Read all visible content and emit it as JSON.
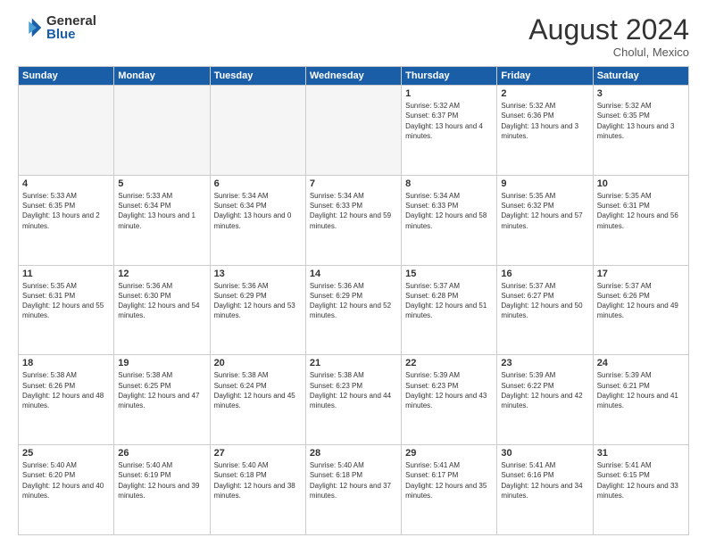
{
  "header": {
    "logo_general": "General",
    "logo_blue": "Blue",
    "month": "August 2024",
    "location": "Cholul, Mexico"
  },
  "weekdays": [
    "Sunday",
    "Monday",
    "Tuesday",
    "Wednesday",
    "Thursday",
    "Friday",
    "Saturday"
  ],
  "weeks": [
    [
      {
        "day": "",
        "empty": true
      },
      {
        "day": "",
        "empty": true
      },
      {
        "day": "",
        "empty": true
      },
      {
        "day": "",
        "empty": true
      },
      {
        "day": "1",
        "sunrise": "5:32 AM",
        "sunset": "6:37 PM",
        "daylight": "13 hours and 4 minutes."
      },
      {
        "day": "2",
        "sunrise": "5:32 AM",
        "sunset": "6:36 PM",
        "daylight": "13 hours and 3 minutes."
      },
      {
        "day": "3",
        "sunrise": "5:32 AM",
        "sunset": "6:35 PM",
        "daylight": "13 hours and 3 minutes."
      }
    ],
    [
      {
        "day": "4",
        "sunrise": "5:33 AM",
        "sunset": "6:35 PM",
        "daylight": "13 hours and 2 minutes."
      },
      {
        "day": "5",
        "sunrise": "5:33 AM",
        "sunset": "6:34 PM",
        "daylight": "13 hours and 1 minute."
      },
      {
        "day": "6",
        "sunrise": "5:34 AM",
        "sunset": "6:34 PM",
        "daylight": "13 hours and 0 minutes."
      },
      {
        "day": "7",
        "sunrise": "5:34 AM",
        "sunset": "6:33 PM",
        "daylight": "12 hours and 59 minutes."
      },
      {
        "day": "8",
        "sunrise": "5:34 AM",
        "sunset": "6:33 PM",
        "daylight": "12 hours and 58 minutes."
      },
      {
        "day": "9",
        "sunrise": "5:35 AM",
        "sunset": "6:32 PM",
        "daylight": "12 hours and 57 minutes."
      },
      {
        "day": "10",
        "sunrise": "5:35 AM",
        "sunset": "6:31 PM",
        "daylight": "12 hours and 56 minutes."
      }
    ],
    [
      {
        "day": "11",
        "sunrise": "5:35 AM",
        "sunset": "6:31 PM",
        "daylight": "12 hours and 55 minutes."
      },
      {
        "day": "12",
        "sunrise": "5:36 AM",
        "sunset": "6:30 PM",
        "daylight": "12 hours and 54 minutes."
      },
      {
        "day": "13",
        "sunrise": "5:36 AM",
        "sunset": "6:29 PM",
        "daylight": "12 hours and 53 minutes."
      },
      {
        "day": "14",
        "sunrise": "5:36 AM",
        "sunset": "6:29 PM",
        "daylight": "12 hours and 52 minutes."
      },
      {
        "day": "15",
        "sunrise": "5:37 AM",
        "sunset": "6:28 PM",
        "daylight": "12 hours and 51 minutes."
      },
      {
        "day": "16",
        "sunrise": "5:37 AM",
        "sunset": "6:27 PM",
        "daylight": "12 hours and 50 minutes."
      },
      {
        "day": "17",
        "sunrise": "5:37 AM",
        "sunset": "6:26 PM",
        "daylight": "12 hours and 49 minutes."
      }
    ],
    [
      {
        "day": "18",
        "sunrise": "5:38 AM",
        "sunset": "6:26 PM",
        "daylight": "12 hours and 48 minutes."
      },
      {
        "day": "19",
        "sunrise": "5:38 AM",
        "sunset": "6:25 PM",
        "daylight": "12 hours and 47 minutes."
      },
      {
        "day": "20",
        "sunrise": "5:38 AM",
        "sunset": "6:24 PM",
        "daylight": "12 hours and 45 minutes."
      },
      {
        "day": "21",
        "sunrise": "5:38 AM",
        "sunset": "6:23 PM",
        "daylight": "12 hours and 44 minutes."
      },
      {
        "day": "22",
        "sunrise": "5:39 AM",
        "sunset": "6:23 PM",
        "daylight": "12 hours and 43 minutes."
      },
      {
        "day": "23",
        "sunrise": "5:39 AM",
        "sunset": "6:22 PM",
        "daylight": "12 hours and 42 minutes."
      },
      {
        "day": "24",
        "sunrise": "5:39 AM",
        "sunset": "6:21 PM",
        "daylight": "12 hours and 41 minutes."
      }
    ],
    [
      {
        "day": "25",
        "sunrise": "5:40 AM",
        "sunset": "6:20 PM",
        "daylight": "12 hours and 40 minutes."
      },
      {
        "day": "26",
        "sunrise": "5:40 AM",
        "sunset": "6:19 PM",
        "daylight": "12 hours and 39 minutes."
      },
      {
        "day": "27",
        "sunrise": "5:40 AM",
        "sunset": "6:18 PM",
        "daylight": "12 hours and 38 minutes."
      },
      {
        "day": "28",
        "sunrise": "5:40 AM",
        "sunset": "6:18 PM",
        "daylight": "12 hours and 37 minutes."
      },
      {
        "day": "29",
        "sunrise": "5:41 AM",
        "sunset": "6:17 PM",
        "daylight": "12 hours and 35 minutes."
      },
      {
        "day": "30",
        "sunrise": "5:41 AM",
        "sunset": "6:16 PM",
        "daylight": "12 hours and 34 minutes."
      },
      {
        "day": "31",
        "sunrise": "5:41 AM",
        "sunset": "6:15 PM",
        "daylight": "12 hours and 33 minutes."
      }
    ]
  ]
}
